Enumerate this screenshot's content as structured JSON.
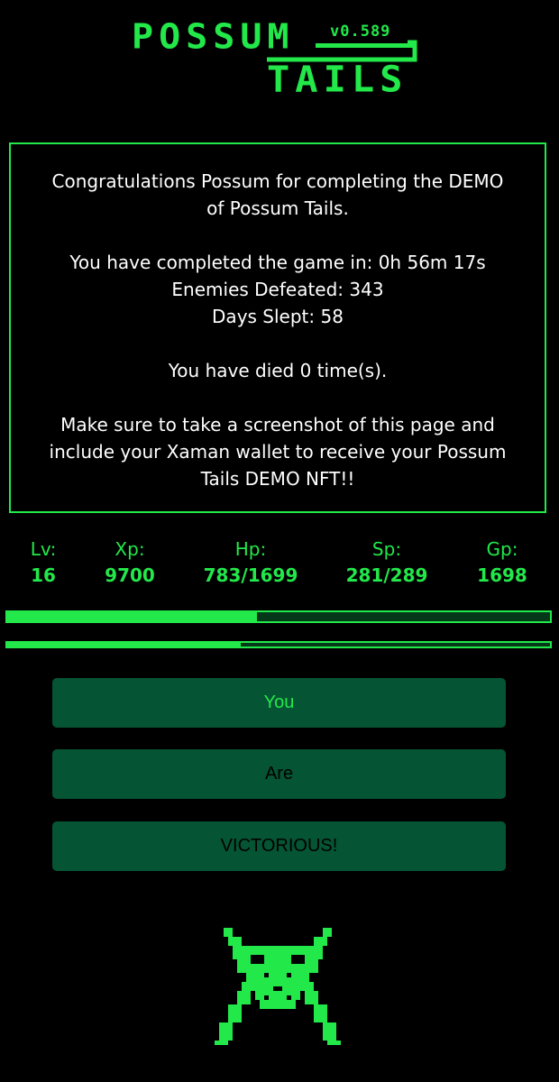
{
  "header": {
    "title_line1": "POSSUM",
    "title_line2": "TAILS",
    "version": "v0.589"
  },
  "message": {
    "congrats_line1": "Congratulations Possum for completing the DEMO",
    "congrats_line2": "of Possum Tails.",
    "completion_time": "You have completed the game in: 0h 56m 17s",
    "enemies_defeated": "Enemies Defeated: 343",
    "days_slept": "Days Slept: 58",
    "deaths": "You have died 0 time(s).",
    "instructions_line1": "Make sure to take a screenshot of this page and",
    "instructions_line2": "include your Xaman wallet to receive your Possum",
    "instructions_line3": "Tails DEMO NFT!!"
  },
  "stats": {
    "level": {
      "label": "Lv:",
      "value": "16"
    },
    "xp": {
      "label": "Xp:",
      "value": "9700"
    },
    "hp": {
      "label": "Hp:",
      "value": "783/1699"
    },
    "sp": {
      "label": "Sp:",
      "value": "281/289"
    },
    "gp": {
      "label": "Gp:",
      "value": "1698"
    }
  },
  "bars": {
    "hp_fraction": 0.46,
    "sp_fraction": 0.43
  },
  "buttons": {
    "you_label": "You",
    "are_label": "Are",
    "victorious_label": "VICTORIOUS!"
  },
  "colors": {
    "accent": "#22e84a",
    "button_bg": "#055434",
    "background": "#000000"
  },
  "icons": {
    "mascot": "possum-mascot-icon"
  }
}
